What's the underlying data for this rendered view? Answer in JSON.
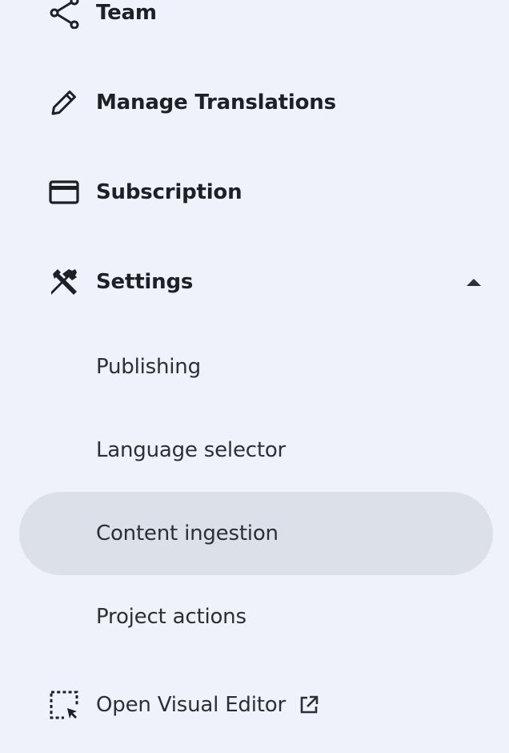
{
  "nav": {
    "items": [
      {
        "label": "Team",
        "icon": "share-icon"
      },
      {
        "label": "Manage Translations",
        "icon": "pencil-icon"
      },
      {
        "label": "Subscription",
        "icon": "credit-card-icon"
      },
      {
        "label": "Settings",
        "icon": "tools-icon",
        "expanded": true
      }
    ],
    "settings_sub": [
      {
        "label": "Publishing"
      },
      {
        "label": "Language selector"
      },
      {
        "label": "Content ingestion",
        "active": true
      },
      {
        "label": "Project actions"
      }
    ],
    "visual_editor": {
      "label": "Open Visual Editor",
      "icon": "select-area-icon",
      "trailing_icon": "external-link-icon"
    }
  },
  "colors": {
    "background": "#eff2fa",
    "active_bg": "#dce0e8",
    "text": "#1f2227"
  }
}
